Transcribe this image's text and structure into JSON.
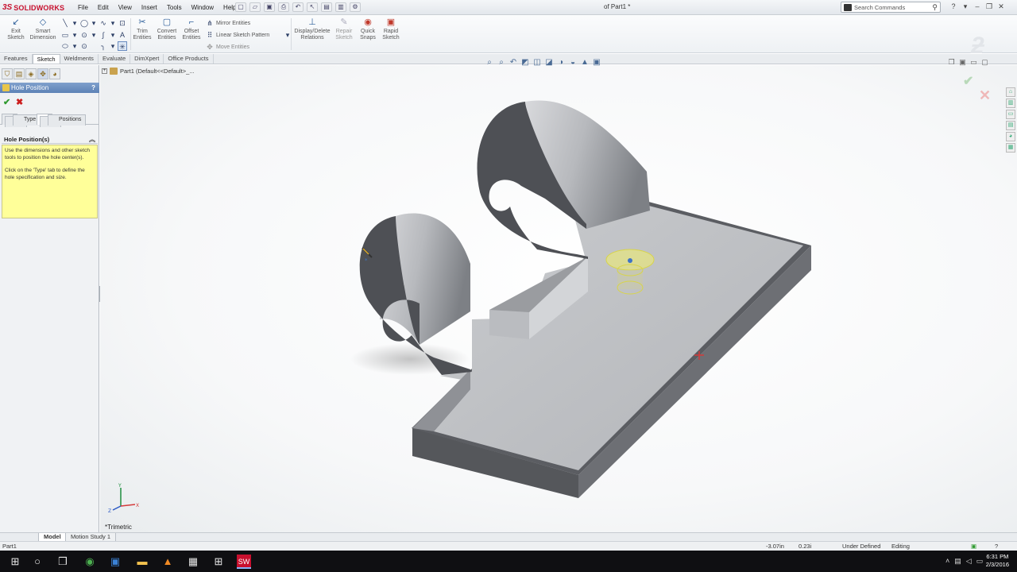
{
  "app": {
    "brand_ds": "3S",
    "brand_name": "SOLIDWORKS",
    "doc_title": "of Part1 *",
    "menus": [
      "File",
      "Edit",
      "View",
      "Insert",
      "Tools",
      "Window",
      "Help"
    ],
    "search_placeholder": "Search Commands",
    "window_buttons": [
      "?",
      "▾",
      "–",
      "❐",
      "✕"
    ]
  },
  "ribbon": {
    "exit_sketch": "Exit Sketch",
    "smart_dimension": "Smart Dimension",
    "trim_entities": "Trim Entities",
    "convert_entities": "Convert Entities",
    "offset_entities": "Offset Entities",
    "mirror_entities": "Mirror Entities",
    "linear_sketch_pattern": "Linear Sketch Pattern",
    "move_entities": "Move Entities",
    "display_delete_relations": "Display/Delete Relations",
    "repair_sketch": "Repair Sketch",
    "quick_snaps": "Quick Snaps",
    "rapid_sketch": "Rapid Sketch"
  },
  "tabs": [
    "Features",
    "Sketch",
    "Weldments",
    "Evaluate",
    "DimXpert",
    "Office Products"
  ],
  "active_tab": "Sketch",
  "property_manager": {
    "title": "Hole Position",
    "help": "?",
    "ok": "✔",
    "cancel": "✖",
    "tab_type": "Type",
    "tab_positions": "Positions",
    "group_title": "Hole Position(s)",
    "message_1": "Use the dimensions and other sketch tools to position the hole center(s).",
    "message_2": "Click on the 'Type' tab to define the hole specification and size."
  },
  "viewport": {
    "tree_label": "Part1  (Default<<Default>_...",
    "view_label": "*Trimetric",
    "triad_x": "X",
    "triad_y": "Y",
    "triad_z": "Z"
  },
  "bottom_tabs": [
    "Model",
    "Motion Study 1"
  ],
  "status": {
    "doc": "Part1",
    "x": "-3.07in",
    "y": "0.23i",
    "definition": "Under Defined",
    "mode": "Editing"
  },
  "clock": {
    "time": "6:31 PM",
    "date": "2/3/2016"
  },
  "colors": {
    "brand": "#c8102e",
    "pm_header": "#6a8cc0",
    "message_bg": "#ffff99",
    "hole_highlight": "#f2f06a"
  }
}
